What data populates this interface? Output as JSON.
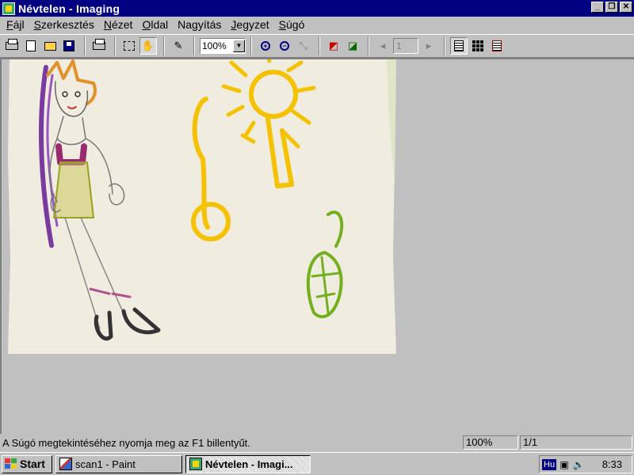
{
  "window": {
    "title": "Névtelen - Imaging"
  },
  "menu": {
    "items": [
      {
        "pre": "",
        "key": "F",
        "post": "ájl"
      },
      {
        "pre": "",
        "key": "S",
        "post": "zerkesztés"
      },
      {
        "pre": "",
        "key": "N",
        "post": "ézet"
      },
      {
        "pre": "",
        "key": "O",
        "post": "ldal"
      },
      {
        "pre": "Na",
        "key": "g",
        "post": "yítás"
      },
      {
        "pre": "",
        "key": "J",
        "post": "egyzet"
      },
      {
        "pre": "",
        "key": "S",
        "post": "úgó"
      }
    ]
  },
  "toolbar": {
    "zoom_value": "100%",
    "page_number": "1"
  },
  "status": {
    "message": "A Súgó megtekintéséhez nyomja meg az F1 billentyűt.",
    "zoom": "100%",
    "pages": "1/1"
  },
  "taskbar": {
    "start_label": "Start",
    "tasks": [
      {
        "label": "scan1 - Paint",
        "icon": "paint-icon"
      },
      {
        "label": "Névtelen - Imagi...",
        "icon": "imaging-icon"
      }
    ],
    "language": "Hu",
    "clock": "8:33"
  },
  "colors": {
    "title_bar": "#000080",
    "face": "#c0c0c0",
    "paper": "#f1ece0"
  }
}
